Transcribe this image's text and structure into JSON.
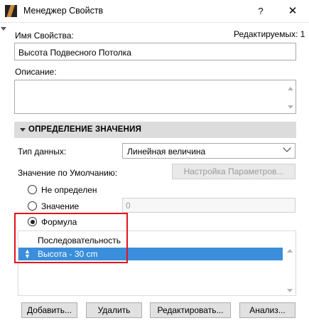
{
  "window": {
    "title": "Менеджер Свойств",
    "help_label": "?",
    "close_label": "✕"
  },
  "property": {
    "name_label": "Имя Свойства:",
    "editable_label": "Редактируемых: 1",
    "name_value": "Высота Подвесного Потолка",
    "description_label": "Описание:",
    "description_value": ""
  },
  "definition": {
    "header": "ОПРЕДЕЛЕНИЕ ЗНАЧЕНИЯ",
    "data_type_label": "Тип данных:",
    "data_type_value": "Линейная величина",
    "default_label": "Значение по Умолчанию:",
    "settings_button": "Настройка Параметров...",
    "options": {
      "undefined": "Не определен",
      "value": "Значение",
      "formula": "Формула"
    },
    "selected_option": "formula",
    "value_field": "0",
    "list_header": "Последовательность",
    "list_items": [
      "Высота - 30 cm"
    ]
  },
  "actions": {
    "add": "Добавить...",
    "delete": "Удалить",
    "edit": "Редактировать...",
    "analyze": "Анализ..."
  },
  "colors": {
    "highlight": "#3a8edb",
    "annotation_box": "#e5131d"
  }
}
